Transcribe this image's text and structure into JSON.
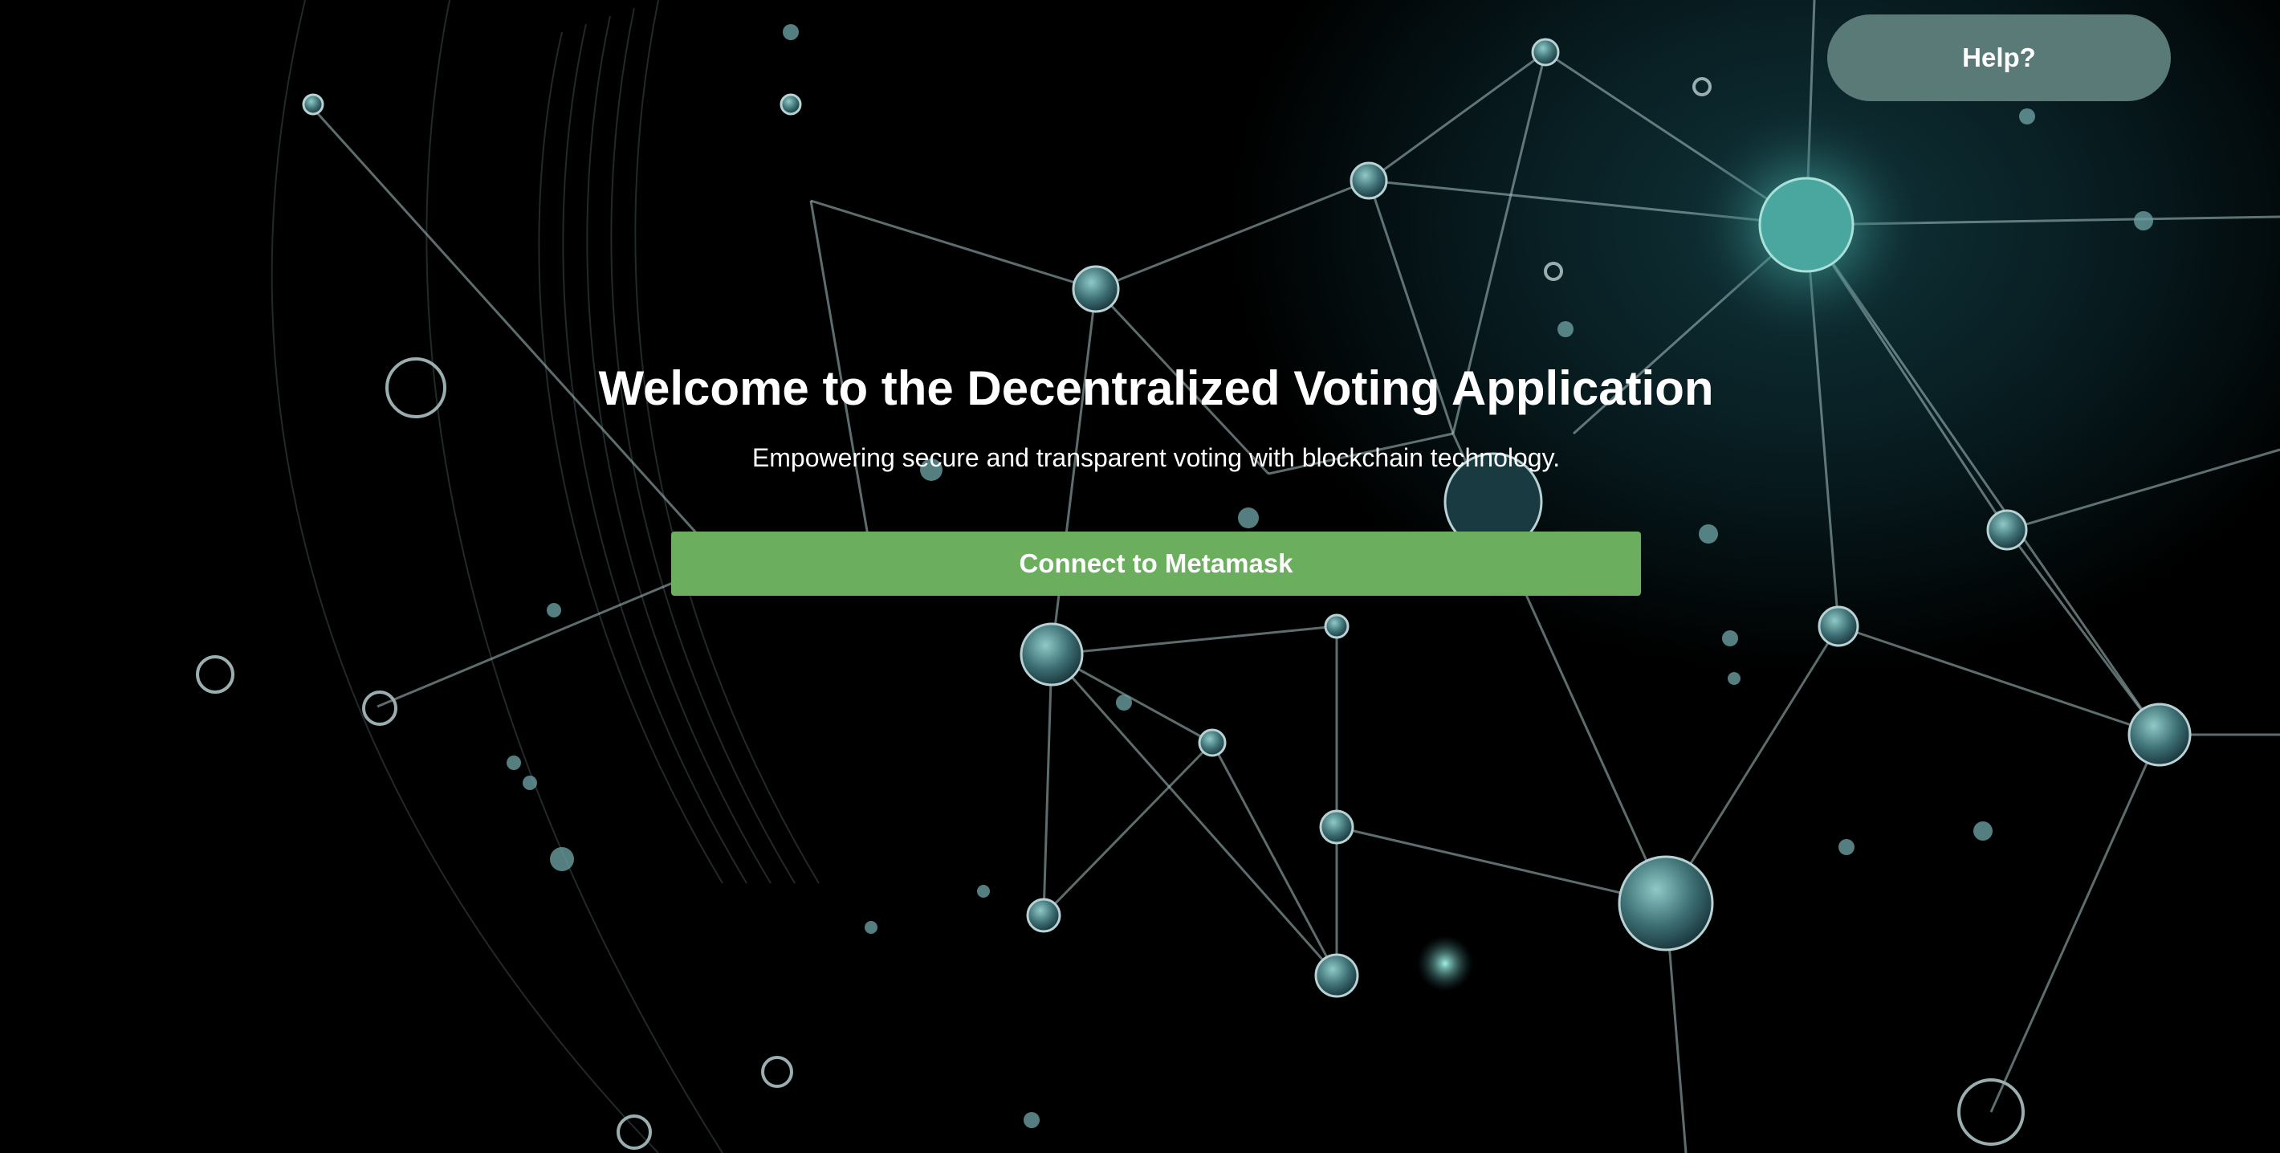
{
  "help": {
    "label": "Help?"
  },
  "hero": {
    "title": "Welcome to the Decentralized Voting Application",
    "subtitle": "Empowering secure and transparent voting with blockchain technology."
  },
  "connect": {
    "label": "Connect to Metamask"
  },
  "colors": {
    "help_button_bg": "#5a7a78",
    "connect_button_bg": "#6aae5e",
    "text": "#ffffff",
    "background": "#000000",
    "node_accent": "#4a9a98"
  }
}
